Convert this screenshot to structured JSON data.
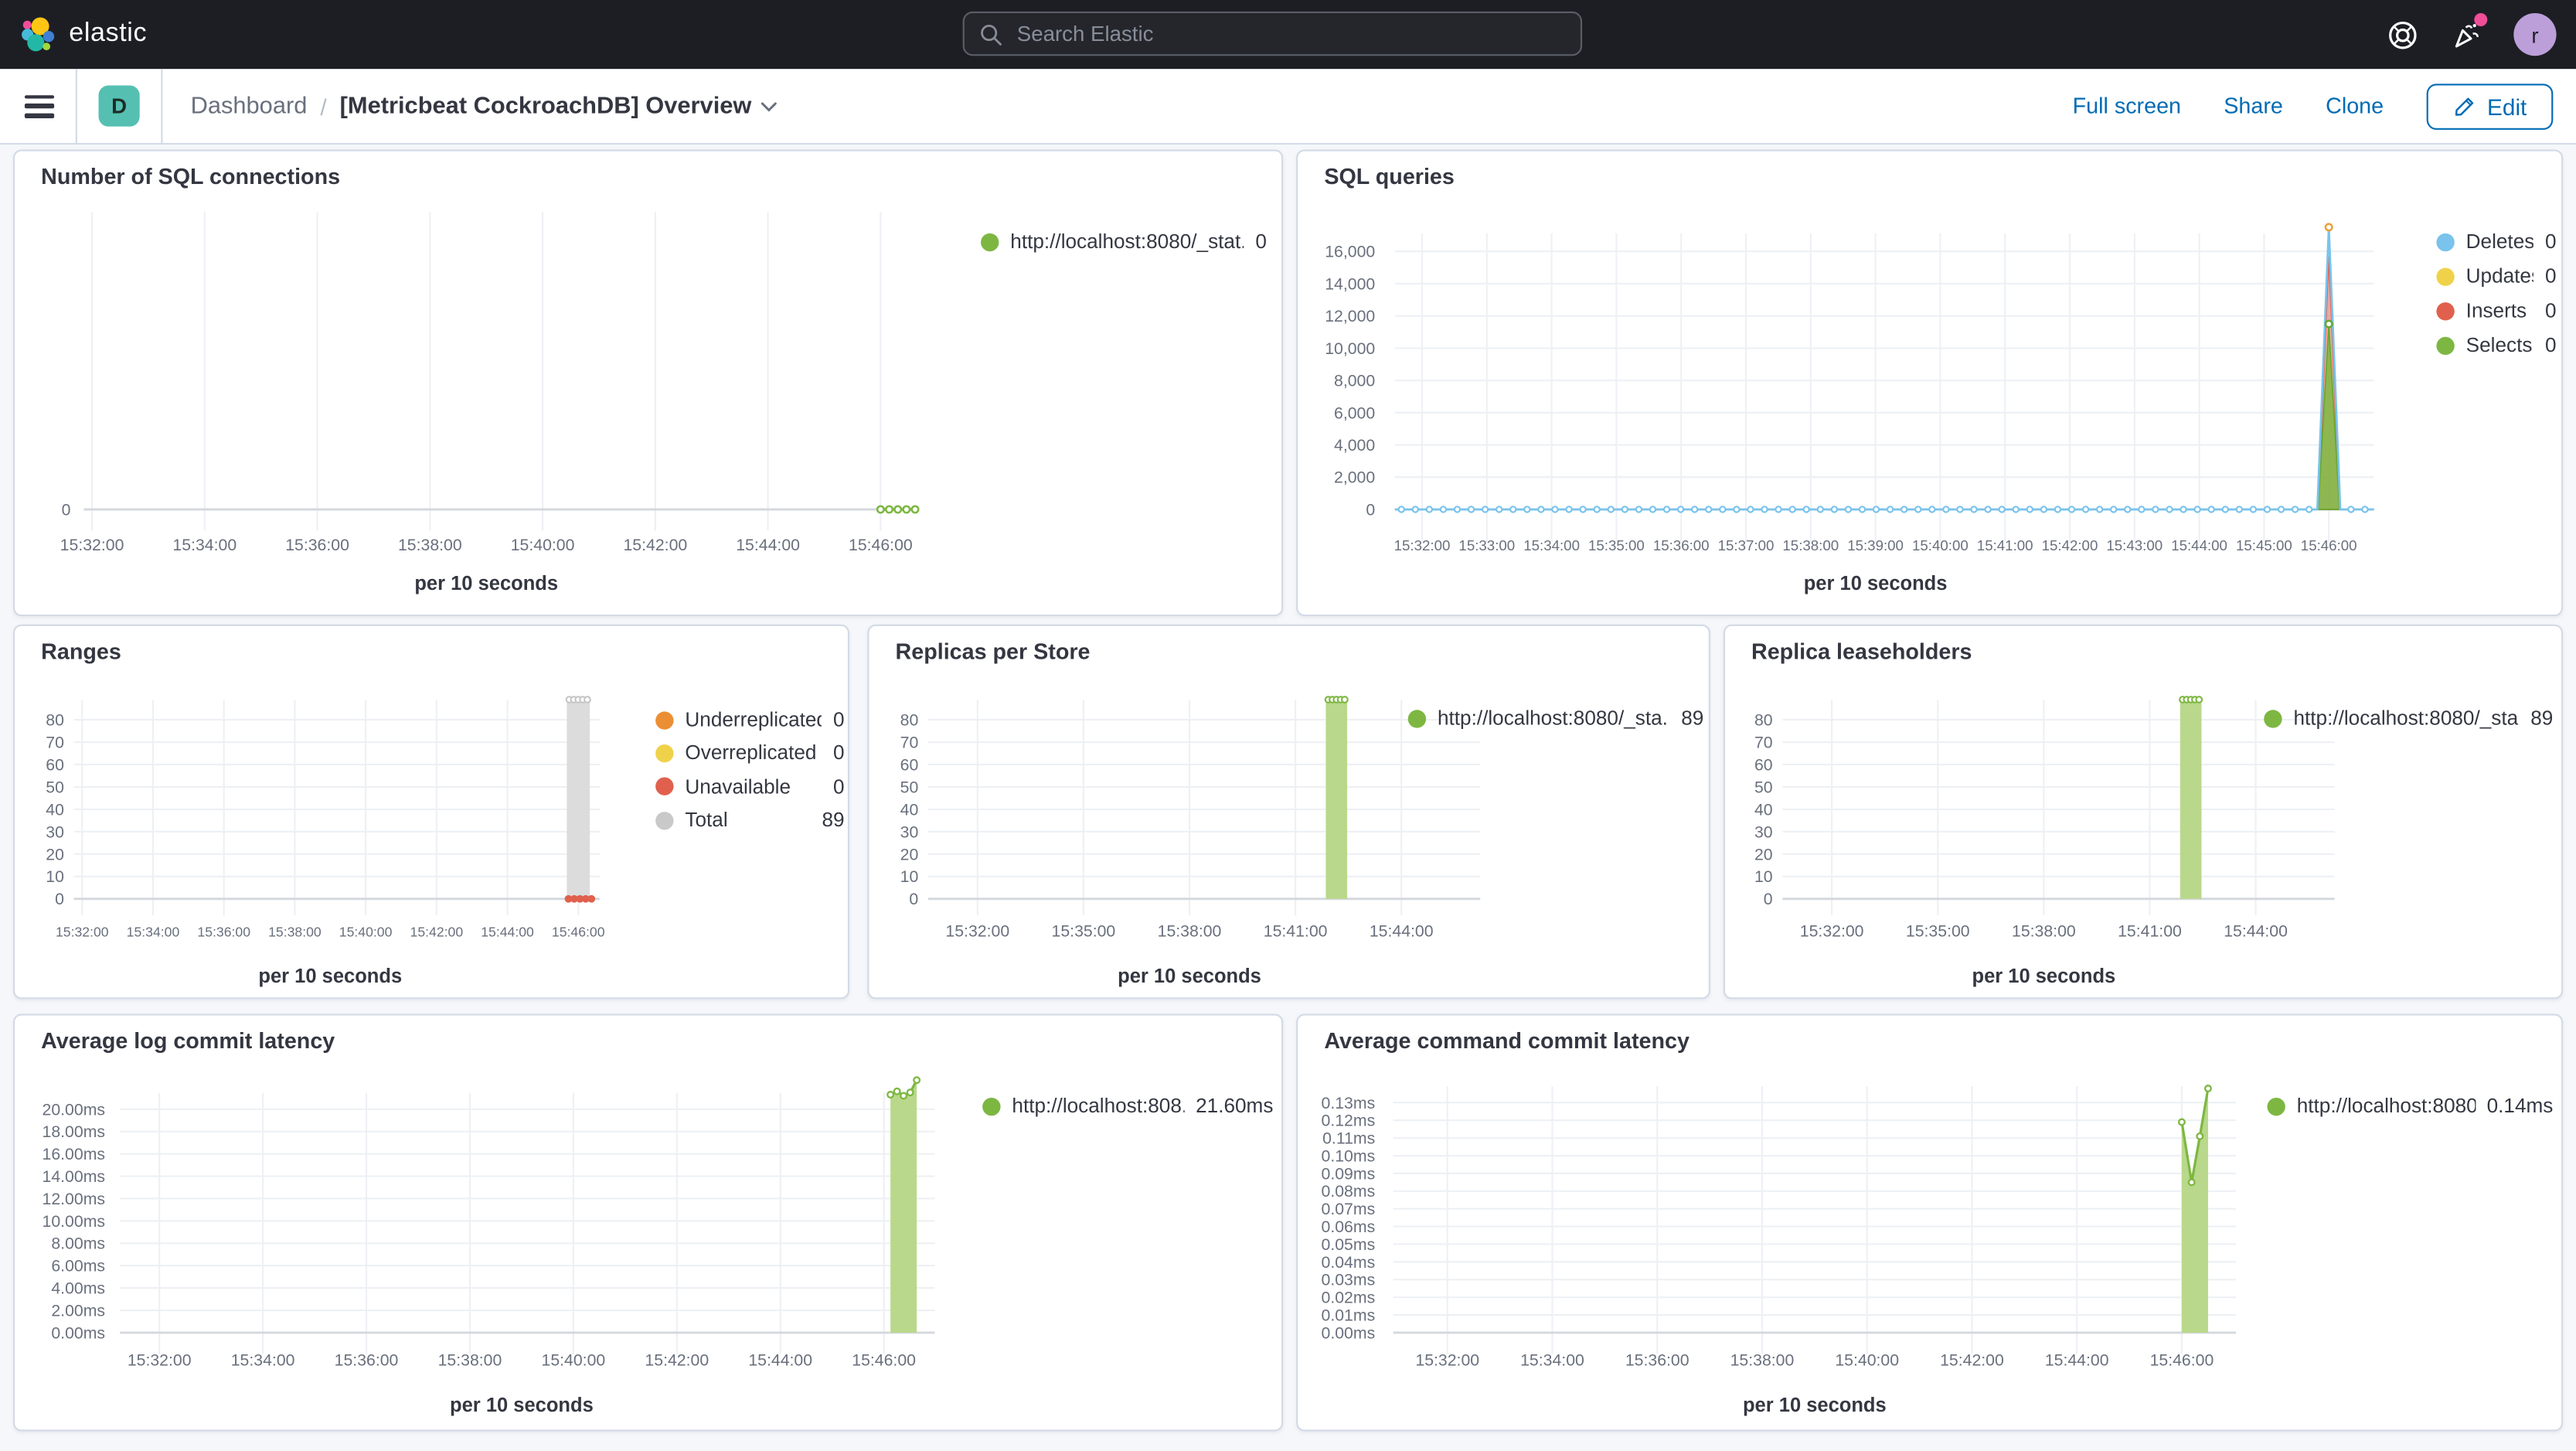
{
  "colors": {
    "link": "#006BB4",
    "header_bg": "#1D1E24",
    "page_bg": "#F5F7FA",
    "panel_border": "#D3DAE6",
    "badge_teal": "#55C0B1",
    "green": "#7DB742",
    "green_fill": "#B9D88B",
    "blue": "#79C3EC",
    "yellow": "#F0D24A",
    "red": "#E0604D",
    "orange": "#EB8F34",
    "gray": "#C9C9C9",
    "notification_pink": "#F04E98",
    "avatar_purple": "#BC9FD9"
  },
  "header": {
    "logo_text": "elastic",
    "search_placeholder": "Search Elastic",
    "user_initial": "r"
  },
  "nav": {
    "space_initial": "D",
    "breadcrumb_root": "Dashboard",
    "separator": "/",
    "title": "[Metricbeat CockroachDB] Overview",
    "actions": [
      "Full screen",
      "Share",
      "Clone"
    ],
    "edit_label": "Edit"
  },
  "panels": [
    {
      "id": "sql-connections",
      "title": "Number of SQL connections",
      "xlabel": "per 10 seconds",
      "x_ticks": [
        "15:32:00",
        "15:34:00",
        "15:36:00",
        "15:38:00",
        "15:40:00",
        "15:42:00",
        "15:44:00",
        "15:46:00"
      ],
      "y_ticks": [
        "0"
      ],
      "legend": [
        {
          "label": "http://localhost:8080/_stat...",
          "value": "0",
          "color": "#7DB742"
        }
      ],
      "chart_data": {
        "type": "line",
        "title": "Number of SQL connections",
        "xlabel": "per 10 seconds",
        "x_ticks": [
          "15:32:00",
          "15:34:00",
          "15:36:00",
          "15:38:00",
          "15:40:00",
          "15:42:00",
          "15:44:00",
          "15:46:00"
        ],
        "ylim": [
          0,
          null
        ],
        "grid": "vertical",
        "legend_position": "right",
        "series": [
          {
            "name": "http://localhost:8080/_stat...",
            "color": "#7DB742",
            "x": [
              "15:46:00",
              "15:46:10",
              "15:46:20",
              "15:46:30",
              "15:46:40"
            ],
            "values": [
              0,
              0,
              0,
              0,
              0
            ]
          }
        ]
      }
    },
    {
      "id": "sql-queries",
      "title": "SQL queries",
      "xlabel": "per 10 seconds",
      "x_ticks": [
        "15:32:00",
        "15:33:00",
        "15:34:00",
        "15:35:00",
        "15:36:00",
        "15:37:00",
        "15:38:00",
        "15:39:00",
        "15:40:00",
        "15:41:00",
        "15:42:00",
        "15:43:00",
        "15:44:00",
        "15:45:00",
        "15:46:00"
      ],
      "y_ticks": [
        "16,000",
        "14,000",
        "12,000",
        "10,000",
        "8,000",
        "6,000",
        "4,000",
        "2,000",
        "0"
      ],
      "legend": [
        {
          "label": "Deletes",
          "value": "0",
          "color": "#79C3EC"
        },
        {
          "label": "Updates",
          "value": "0",
          "color": "#F0D24A"
        },
        {
          "label": "Inserts",
          "value": "0",
          "color": "#E0604D"
        },
        {
          "label": "Selects",
          "value": "0",
          "color": "#7DB742"
        }
      ],
      "chart_data": {
        "type": "area",
        "title": "SQL queries",
        "xlabel": "per 10 seconds",
        "ylim": [
          0,
          17500
        ],
        "grid": "both",
        "legend_position": "right",
        "x_ticks": [
          "15:32:00",
          "15:33:00",
          "15:34:00",
          "15:35:00",
          "15:36:00",
          "15:37:00",
          "15:38:00",
          "15:39:00",
          "15:40:00",
          "15:41:00",
          "15:42:00",
          "15:43:00",
          "15:44:00",
          "15:45:00",
          "15:46:00"
        ],
        "series": [
          {
            "name": "Deletes",
            "color": "#79C3EC",
            "baseline": 0,
            "peak_value": 17500,
            "peak_time": "15:46:00"
          },
          {
            "name": "Updates",
            "color": "#F0D24A",
            "baseline": 0,
            "peak_value": 0,
            "peak_time": "15:46:00"
          },
          {
            "name": "Inserts",
            "color": "#E0604D",
            "baseline": 0,
            "peak_value": 15700,
            "peak_time": "15:46:00"
          },
          {
            "name": "Selects",
            "color": "#7DB742",
            "baseline": 0,
            "peak_value": 11500,
            "peak_time": "15:46:00"
          }
        ]
      }
    },
    {
      "id": "ranges",
      "title": "Ranges",
      "xlabel": "per 10 seconds",
      "x_ticks": [
        "15:32:00",
        "15:34:00",
        "15:36:00",
        "15:38:00",
        "15:40:00",
        "15:42:00",
        "15:44:00",
        "15:46:00"
      ],
      "y_ticks": [
        "80",
        "70",
        "60",
        "50",
        "40",
        "30",
        "20",
        "10",
        "0"
      ],
      "legend": [
        {
          "label": "Underreplicated",
          "value": "0",
          "color": "#EB8F34"
        },
        {
          "label": "Overreplicated",
          "value": "0",
          "color": "#F0D24A"
        },
        {
          "label": "Unavailable",
          "value": "0",
          "color": "#E0604D"
        },
        {
          "label": "Total",
          "value": "89",
          "color": "#C9C9C9"
        }
      ],
      "chart_data": {
        "type": "bar",
        "title": "Ranges",
        "xlabel": "per 10 seconds",
        "ylim": [
          0,
          89
        ],
        "x_ticks": [
          "15:32:00",
          "15:34:00",
          "15:36:00",
          "15:38:00",
          "15:40:00",
          "15:42:00",
          "15:44:00",
          "15:46:00"
        ],
        "series": [
          {
            "name": "Underreplicated",
            "color": "#EB8F34",
            "value": 0,
            "time": "15:46:00"
          },
          {
            "name": "Overreplicated",
            "color": "#F0D24A",
            "value": 0,
            "time": "15:46:00"
          },
          {
            "name": "Unavailable",
            "color": "#E0604D",
            "value": 0,
            "time": "15:46:00"
          },
          {
            "name": "Total",
            "color": "#C9C9C9",
            "value": 89,
            "time": "15:46:00"
          }
        ]
      }
    },
    {
      "id": "replicas",
      "title": "Replicas per Store",
      "xlabel": "per 10 seconds",
      "x_ticks": [
        "15:32:00",
        "15:35:00",
        "15:38:00",
        "15:41:00",
        "15:44:00"
      ],
      "y_ticks": [
        "80",
        "70",
        "60",
        "50",
        "40",
        "30",
        "20",
        "10",
        "0"
      ],
      "legend": [
        {
          "label": "http://localhost:8080/_sta...",
          "value": "89",
          "color": "#7DB742"
        }
      ],
      "chart_data": {
        "type": "bar",
        "title": "Replicas per Store",
        "xlabel": "per 10 seconds",
        "ylim": [
          0,
          89
        ],
        "x_ticks": [
          "15:32:00",
          "15:35:00",
          "15:38:00",
          "15:41:00",
          "15:44:00"
        ],
        "series": [
          {
            "name": "http://localhost:8080/_sta...",
            "color": "#7DB742",
            "value": 89,
            "time": "15:45:40"
          }
        ]
      }
    },
    {
      "id": "leaseholders",
      "title": "Replica leaseholders",
      "xlabel": "per 10 seconds",
      "x_ticks": [
        "15:32:00",
        "15:35:00",
        "15:38:00",
        "15:41:00",
        "15:44:00"
      ],
      "y_ticks": [
        "80",
        "70",
        "60",
        "50",
        "40",
        "30",
        "20",
        "10",
        "0"
      ],
      "legend": [
        {
          "label": "http://localhost:8080/_sta...",
          "value": "89",
          "color": "#7DB742"
        }
      ],
      "chart_data": {
        "type": "bar",
        "title": "Replica leaseholders",
        "xlabel": "per 10 seconds",
        "ylim": [
          0,
          89
        ],
        "x_ticks": [
          "15:32:00",
          "15:35:00",
          "15:38:00",
          "15:41:00",
          "15:44:00"
        ],
        "series": [
          {
            "name": "http://localhost:8080/_sta...",
            "color": "#7DB742",
            "value": 89,
            "time": "15:45:40"
          }
        ]
      }
    },
    {
      "id": "log-commit",
      "title": "Average log commit latency",
      "xlabel": "per 10 seconds",
      "x_ticks": [
        "15:32:00",
        "15:34:00",
        "15:36:00",
        "15:38:00",
        "15:40:00",
        "15:42:00",
        "15:44:00",
        "15:46:00"
      ],
      "y_ticks": [
        "20.00ms",
        "18.00ms",
        "16.00ms",
        "14.00ms",
        "12.00ms",
        "10.00ms",
        "8.00ms",
        "6.00ms",
        "4.00ms",
        "2.00ms",
        "0.00ms"
      ],
      "legend": [
        {
          "label": "http://localhost:808...",
          "value": "21.60ms",
          "color": "#7DB742"
        }
      ],
      "chart_data": {
        "type": "area",
        "title": "Average log commit latency",
        "xlabel": "per 10 seconds",
        "ylim_ms": [
          0,
          22.6
        ],
        "grid": "both",
        "legend_position": "right",
        "x_ticks": [
          "15:32:00",
          "15:34:00",
          "15:36:00",
          "15:38:00",
          "15:40:00",
          "15:42:00",
          "15:44:00",
          "15:46:00"
        ],
        "series": [
          {
            "name": "http://localhost:808...",
            "color": "#7DB742",
            "x": [
              "15:45:50",
              "15:46:00",
              "15:46:10",
              "15:46:20",
              "15:46:30"
            ],
            "values_ms": [
              21.3,
              21.6,
              21.2,
              21.5,
              22.6
            ],
            "last_value_label": "21.60ms"
          }
        ]
      }
    },
    {
      "id": "cmd-commit",
      "title": "Average command commit latency",
      "xlabel": "per 10 seconds",
      "x_ticks": [
        "15:32:00",
        "15:34:00",
        "15:36:00",
        "15:38:00",
        "15:40:00",
        "15:42:00",
        "15:44:00",
        "15:46:00"
      ],
      "y_ticks": [
        "0.13ms",
        "0.12ms",
        "0.11ms",
        "0.10ms",
        "0.09ms",
        "0.08ms",
        "0.07ms",
        "0.06ms",
        "0.05ms",
        "0.04ms",
        "0.03ms",
        "0.02ms",
        "0.01ms",
        "0.00ms"
      ],
      "legend": [
        {
          "label": "http://localhost:8080...",
          "value": "0.14ms",
          "color": "#7DB742"
        }
      ],
      "chart_data": {
        "type": "area",
        "title": "Average command commit latency",
        "xlabel": "per 10 seconds",
        "ylim_ms": [
          0,
          0.14
        ],
        "grid": "both",
        "legend_position": "right",
        "x_ticks": [
          "15:32:00",
          "15:34:00",
          "15:36:00",
          "15:38:00",
          "15:40:00",
          "15:42:00",
          "15:44:00",
          "15:46:00"
        ],
        "series": [
          {
            "name": "http://localhost:8080...",
            "color": "#7DB742",
            "x": [
              "15:46:00",
              "15:46:10",
              "15:46:20",
              "15:46:30"
            ],
            "values_ms": [
              0.119,
              0.085,
              0.111,
              0.138
            ],
            "last_value_label": "0.14ms"
          }
        ]
      }
    }
  ]
}
